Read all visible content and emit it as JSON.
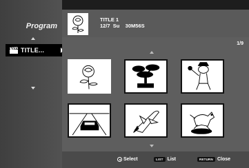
{
  "sidebar": {
    "title": "Program",
    "items": [
      {
        "label": "TITLE...",
        "icon": "clapperboard-icon",
        "selected": true
      }
    ]
  },
  "info": {
    "title": "TITLE 1",
    "details": "12/7  Su    30M56S",
    "thumbnail": "rose-icon"
  },
  "grid": {
    "page": "1/9",
    "thumbnails": [
      {
        "icon": "rose-icon"
      },
      {
        "icon": "bonsai-tree-icon"
      },
      {
        "icon": "musician-dog-icon"
      },
      {
        "icon": "car-road-icon"
      },
      {
        "icon": "space-shuttle-icon"
      },
      {
        "icon": "running-dog-icon"
      }
    ]
  },
  "footer": {
    "select_label": "Select",
    "list_key": "LIST",
    "list_label": "List",
    "return_key": "RETURN",
    "close_label": "Close"
  }
}
